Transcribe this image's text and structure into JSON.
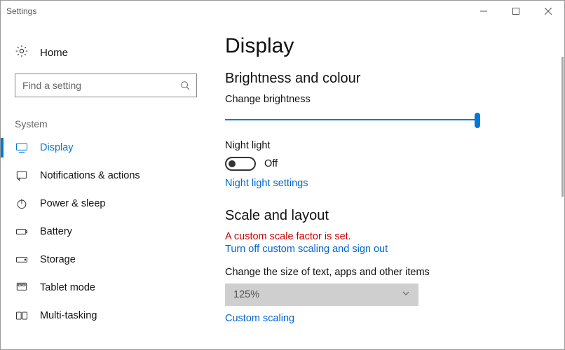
{
  "window": {
    "title": "Settings"
  },
  "sidebar": {
    "home": "Home",
    "search_placeholder": "Find a setting",
    "group": "System",
    "items": [
      {
        "label": "Display"
      },
      {
        "label": "Notifications & actions"
      },
      {
        "label": "Power & sleep"
      },
      {
        "label": "Battery"
      },
      {
        "label": "Storage"
      },
      {
        "label": "Tablet mode"
      },
      {
        "label": "Multi-tasking"
      }
    ]
  },
  "main": {
    "title": "Display",
    "section1": "Brightness and colour",
    "brightness_label": "Change brightness",
    "brightness_pct": 100,
    "night_light_label": "Night light",
    "night_light_state": "Off",
    "night_light_link": "Night light settings",
    "section2": "Scale and layout",
    "scale_warning": "A custom scale factor is set.",
    "scale_turnoff_link": "Turn off custom scaling and sign out",
    "scale_label": "Change the size of text, apps and other items",
    "scale_value": "125%",
    "custom_scaling_link": "Custom scaling"
  }
}
